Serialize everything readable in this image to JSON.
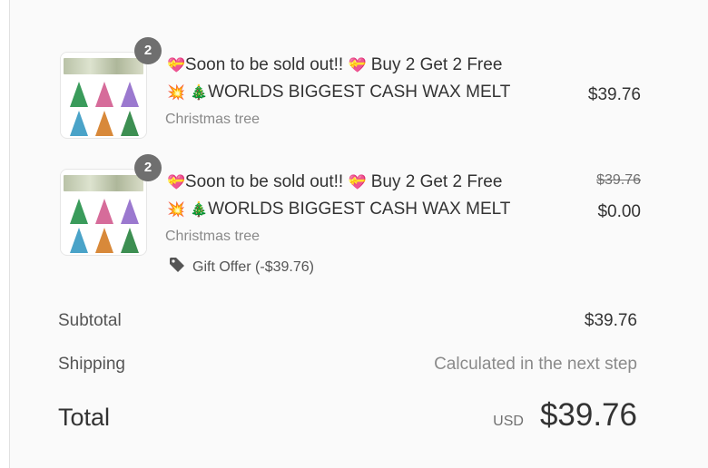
{
  "items": [
    {
      "quantity": "2",
      "title_line1": "Soon to be sold out!!",
      "title_line1b": "Buy 2 Get 2 Free",
      "title_line2": "WORLDS BIGGEST CASH WAX MELT",
      "variant": "Christmas tree",
      "price": "$39.76"
    },
    {
      "quantity": "2",
      "title_line1": "Soon to be sold out!!",
      "title_line1b": "Buy 2 Get 2 Free",
      "title_line2": "WORLDS BIGGEST CASH WAX MELT",
      "variant": "Christmas tree",
      "original_price": "$39.76",
      "price": "$0.00",
      "discount": "Gift Offer (-$39.76)"
    }
  ],
  "summary": {
    "subtotal_label": "Subtotal",
    "subtotal_value": "$39.76",
    "shipping_label": "Shipping",
    "shipping_value": "Calculated in the next step",
    "total_label": "Total",
    "currency": "USD",
    "total_value": "$39.76"
  },
  "icons": {
    "heart": "heart-ribbon-emoji",
    "collision": "collision-emoji",
    "tree": "christmas-tree-emoji",
    "tag": "tag-icon"
  },
  "colors": {
    "panel_bg": "#fafafa",
    "badge_bg": "#6f6f6f"
  }
}
